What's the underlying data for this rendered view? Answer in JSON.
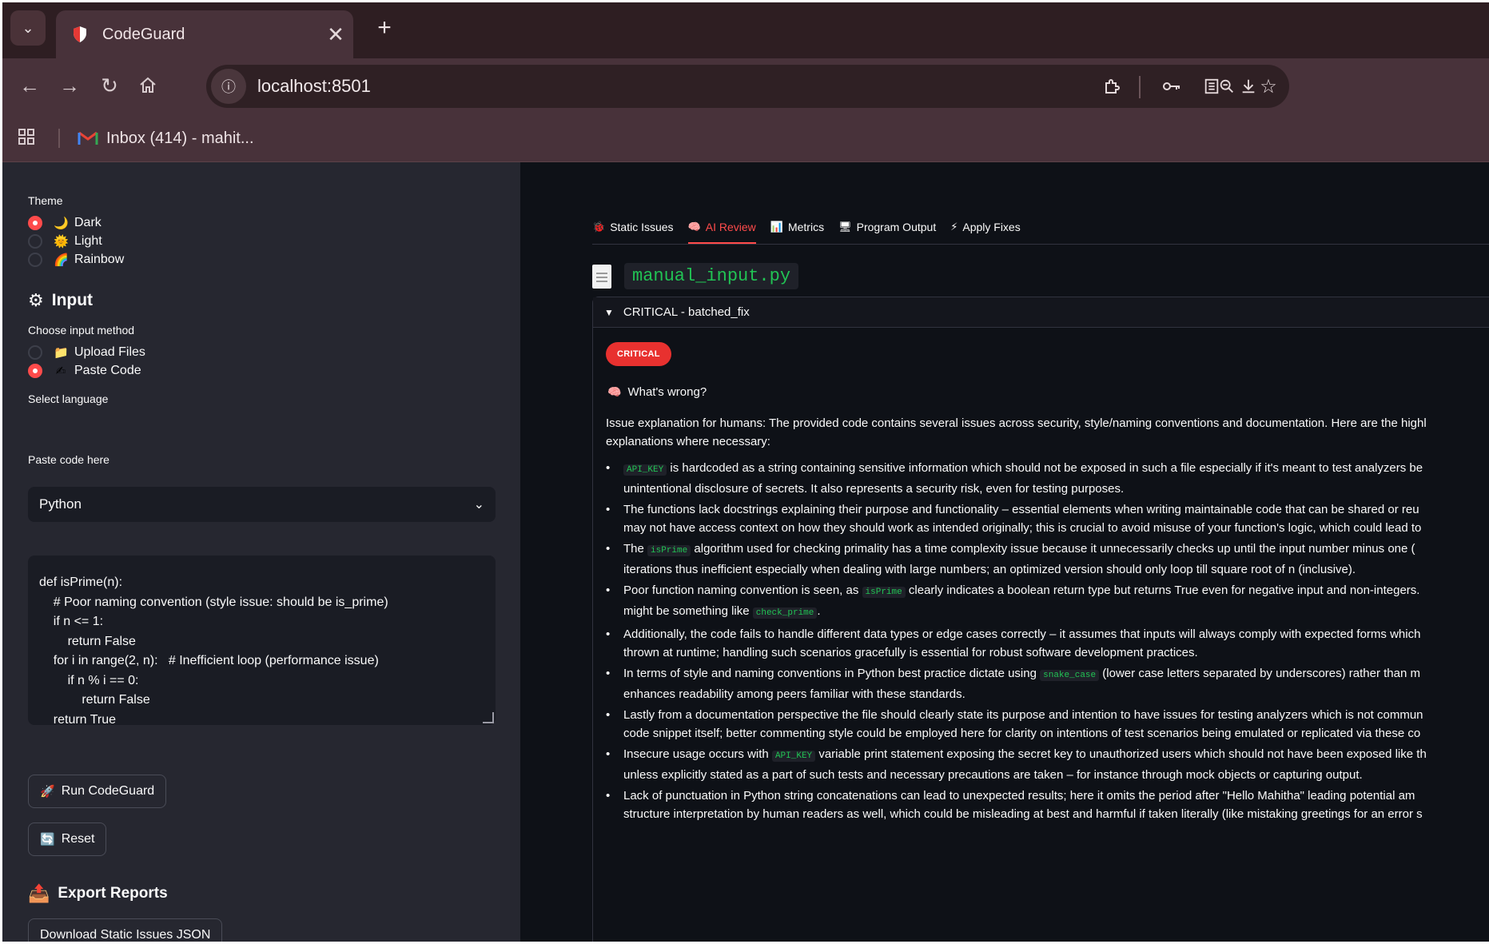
{
  "browser": {
    "tab_title": "CodeGuard",
    "tab_close": "✕",
    "new_tab": "+",
    "url": "localhost:8501",
    "bookmark_label": "Inbox (414) - mahit..."
  },
  "sidebar": {
    "theme_label": "Theme",
    "themes": [
      {
        "label": "Dark",
        "icon": "🌙",
        "selected": true
      },
      {
        "label": "Light",
        "icon": "🌞",
        "selected": false
      },
      {
        "label": "Rainbow",
        "icon": "🌈",
        "selected": false
      }
    ],
    "input_heading": "Input",
    "input_method_label": "Choose input method",
    "input_methods": [
      {
        "label": "Upload Files",
        "icon": "📁",
        "selected": false
      },
      {
        "label": "Paste Code",
        "icon": "✍",
        "selected": true
      }
    ],
    "language_label": "Select language",
    "language_value": "Python",
    "paste_label": "Paste code here",
    "code_lines": [
      "def isPrime(n):",
      "    # Poor naming convention (style issue: should be is_prime)",
      "    if n <= 1:",
      "        return False",
      "    for i in range(2, n):   # Inefficient loop (performance issue)",
      "        if n % i == 0:",
      "            return False",
      "    return True"
    ],
    "run_button": "Run CodeGuard",
    "reset_button": "Reset",
    "export_heading": "Export Reports",
    "download_button": "Download Static Issues JSON"
  },
  "main": {
    "tabs": [
      {
        "label": "Static Issues",
        "icon": "🐞",
        "active": false
      },
      {
        "label": "AI Review",
        "icon": "🧠",
        "active": true
      },
      {
        "label": "Metrics",
        "icon": "📊",
        "active": false
      },
      {
        "label": "Program Output",
        "icon": "🖥",
        "active": false
      },
      {
        "label": "Apply Fixes",
        "icon": "⚡",
        "active": false
      }
    ],
    "file_name": "manual_input.py",
    "expander_title": "CRITICAL - batched_fix",
    "badge": "CRITICAL",
    "wrong_heading": "What's wrong?",
    "intro_line1": "Issue explanation for humans: The provided code contains several issues across security, style/naming conventions and documentation. Here are the highl",
    "intro_line2": "explanations where necessary:",
    "bullets": [
      {
        "pre": "",
        "code": "API_KEY",
        "post": " is hardcoded as a string containing sensitive information which should not be exposed in such a file especially if it's meant to test analyzers be",
        "line2": "unintentional disclosure of secrets. It also represents a security risk, even for testing purposes."
      },
      {
        "pre": "The functions lack docstrings explaining their purpose and functionality – essential elements when writing maintainable code that can be shared or reu",
        "code": "",
        "post": "",
        "line2": "may not have access context on how they should work as intended originally; this is crucial to avoid misuse of your function's logic, which could lead to"
      },
      {
        "pre": "The ",
        "code": "isPrime",
        "post": " algorithm used for checking primality has a time complexity issue because it unnecessarily checks up until the input number minus one (",
        "line2": "iterations thus inefficient especially when dealing with large numbers; an optimized version should only loop till square root of n (inclusive)."
      },
      {
        "pre": "Poor function naming convention is seen, as ",
        "code": "isPrime",
        "post": " clearly indicates a boolean return type but returns True even for negative input and non-integers.",
        "line2": "might be something like ",
        "code2": "check_prime",
        "line2_end": "."
      },
      {
        "pre": "Additionally, the code fails to handle different data types or edge cases correctly – it assumes that inputs will always comply with expected forms which",
        "code": "",
        "post": "",
        "line2": "thrown at runtime; handling such scenarios gracefully is essential for robust software development practices."
      },
      {
        "pre": "In terms of style and naming conventions in Python best practice dictate using ",
        "code": "snake_case",
        "post": " (lower case letters separated by underscores) rather than m",
        "line2": "enhances readability among peers familiar with these standards."
      },
      {
        "pre": "Lastly from a documentation perspective the file should clearly state its purpose and intention to have issues for testing analyzers which is not commun",
        "code": "",
        "post": "",
        "line2": "code snippet itself; better commenting style could be employed here for clarity on intentions of test scenarios being emulated or replicated via these co"
      },
      {
        "pre": "Insecure usage occurs with ",
        "code": "API_KEY",
        "post": " variable print statement exposing the secret key to unauthorized users which should not have been exposed like th",
        "line2": "unless explicitly stated as a part of such tests and necessary precautions are taken – for instance through mock objects or capturing output."
      },
      {
        "pre": "Lack of punctuation in Python string concatenations can lead to unexpected results; here it omits the period after \"Hello Mahitha\" leading potential am",
        "code": "",
        "post": "",
        "line2": "structure interpretation by human readers as well, which could be misleading at best and harmful if taken literally (like mistaking greetings for an error s"
      }
    ]
  },
  "colors": {
    "accent": "#ff4b4b",
    "badge": "#e8312f",
    "code_green": "#21c354",
    "sidebar_bg": "#262730",
    "main_bg": "#0e1117",
    "chrome_bg": "#48323a"
  }
}
